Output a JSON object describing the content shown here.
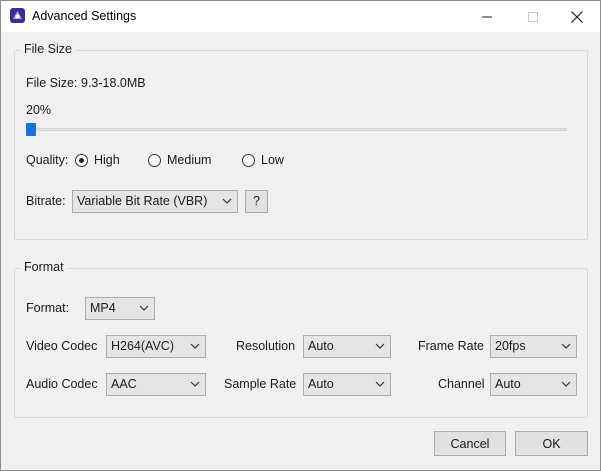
{
  "window": {
    "title": "Advanced Settings",
    "icon": "app-logo-icon",
    "controls": [
      "minimize-icon",
      "maximize-icon",
      "close-icon"
    ]
  },
  "file_size_group": {
    "legend": "File Size",
    "file_size_label": "File Size:",
    "file_size_value": "9.3-18.0MB",
    "percent_text": "20%",
    "slider_value_percent": 20,
    "quality_label": "Quality:",
    "quality_options": [
      {
        "label": "High",
        "checked": true
      },
      {
        "label": "Medium",
        "checked": false
      },
      {
        "label": "Low",
        "checked": false
      }
    ],
    "bitrate_label": "Bitrate:",
    "bitrate_value": "Variable Bit Rate (VBR)",
    "help_button": "?"
  },
  "format_group": {
    "legend": "Format",
    "format_label": "Format:",
    "format_value": "MP4",
    "video_codec_label": "Video Codec",
    "video_codec_value": "H264(AVC)",
    "resolution_label": "Resolution",
    "resolution_value": "Auto",
    "frame_rate_label": "Frame Rate",
    "frame_rate_value": "20fps",
    "audio_codec_label": "Audio Codec",
    "audio_codec_value": "AAC",
    "sample_rate_label": "Sample Rate",
    "sample_rate_value": "Auto",
    "channel_label": "Channel",
    "channel_value": "Auto"
  },
  "footer": {
    "cancel_label": "Cancel",
    "ok_label": "OK"
  },
  "colors": {
    "accent": "#1a73d9",
    "background": "#f0f0f0"
  }
}
